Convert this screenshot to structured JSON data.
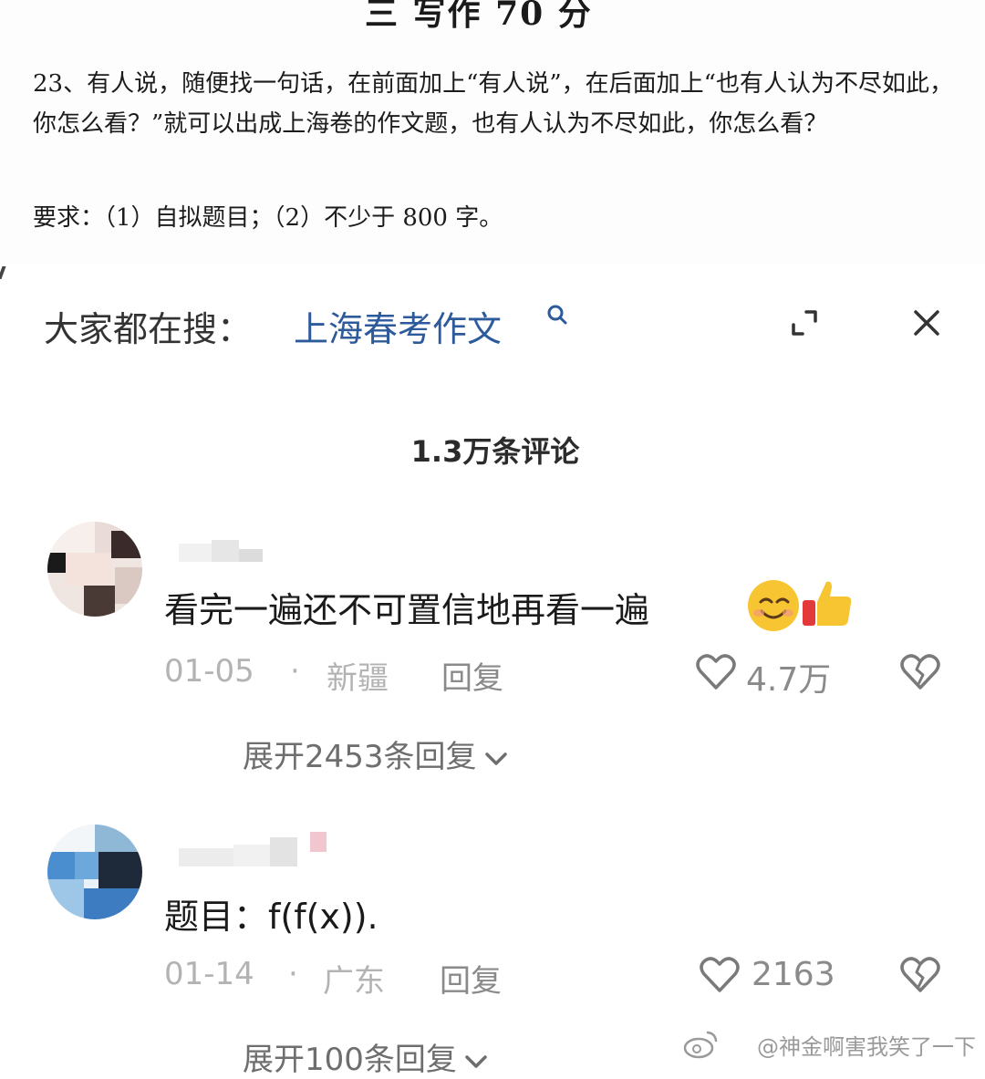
{
  "exam": {
    "heading": "三  写作  70 分",
    "question": "23、有人说，随便找一句话，在前面加上“有人说”，在后面加上“也有人认为不尽如此，你怎么看？”就可以出成上海卷的作文题，也有人认为不尽如此，你怎么看？",
    "requirements": "要求：（1）自拟题目；（2）不少于 800 字。"
  },
  "search": {
    "prefix": "大家都在搜：",
    "term": "上海春考作文",
    "icons": [
      "search-icon",
      "expand-icon",
      "close-icon"
    ]
  },
  "comments_header": {
    "count_label": "1.3万条评论"
  },
  "comments": [
    {
      "text": "看完一遍还不可置信地再看一遍",
      "emojis": [
        "smiling-face-emoji",
        "thumbs-up-emoji"
      ],
      "date": "01-05",
      "separator": "·",
      "location": "新疆",
      "reply_label": "回复",
      "likes": "4.7万",
      "expand_label": "展开2453条回复"
    },
    {
      "text": "题目：f(f(x)).",
      "date": "01-14",
      "separator": "·",
      "location": "广东",
      "reply_label": "回复",
      "likes": "2163",
      "expand_label": "展开100条回复"
    }
  ],
  "watermark": {
    "text": "@神金啊害我笑了一下"
  },
  "colors": {
    "search_term": "#2d5a9a",
    "meta": "#b3b3b3",
    "secondary": "#8a8a8a"
  }
}
